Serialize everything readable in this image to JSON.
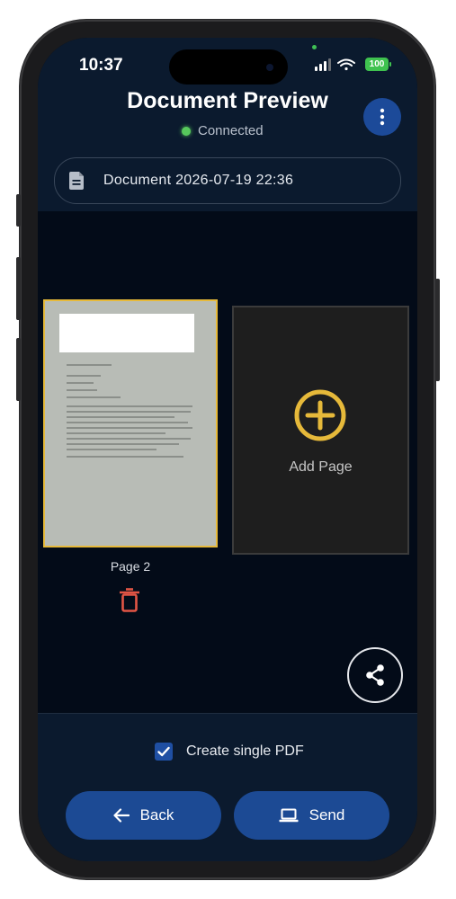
{
  "status_bar": {
    "time": "10:37",
    "battery": "100"
  },
  "header": {
    "title": "Document Preview",
    "connection_status": "Connected"
  },
  "document": {
    "name": "Document 2026-07-19 22:36"
  },
  "pages": [
    {
      "label": "Page 2"
    }
  ],
  "add_page": {
    "label": "Add Page"
  },
  "options": {
    "create_single_pdf_label": "Create single PDF",
    "create_single_pdf_checked": true
  },
  "actions": {
    "back_label": "Back",
    "send_label": "Send"
  },
  "colors": {
    "background": "#030b18",
    "bar": "#0b1a2e",
    "primary_button": "#1c4a94",
    "accent_yellow": "#e6b93a",
    "delete_red": "#e25545",
    "connected_green": "#57c95c"
  }
}
